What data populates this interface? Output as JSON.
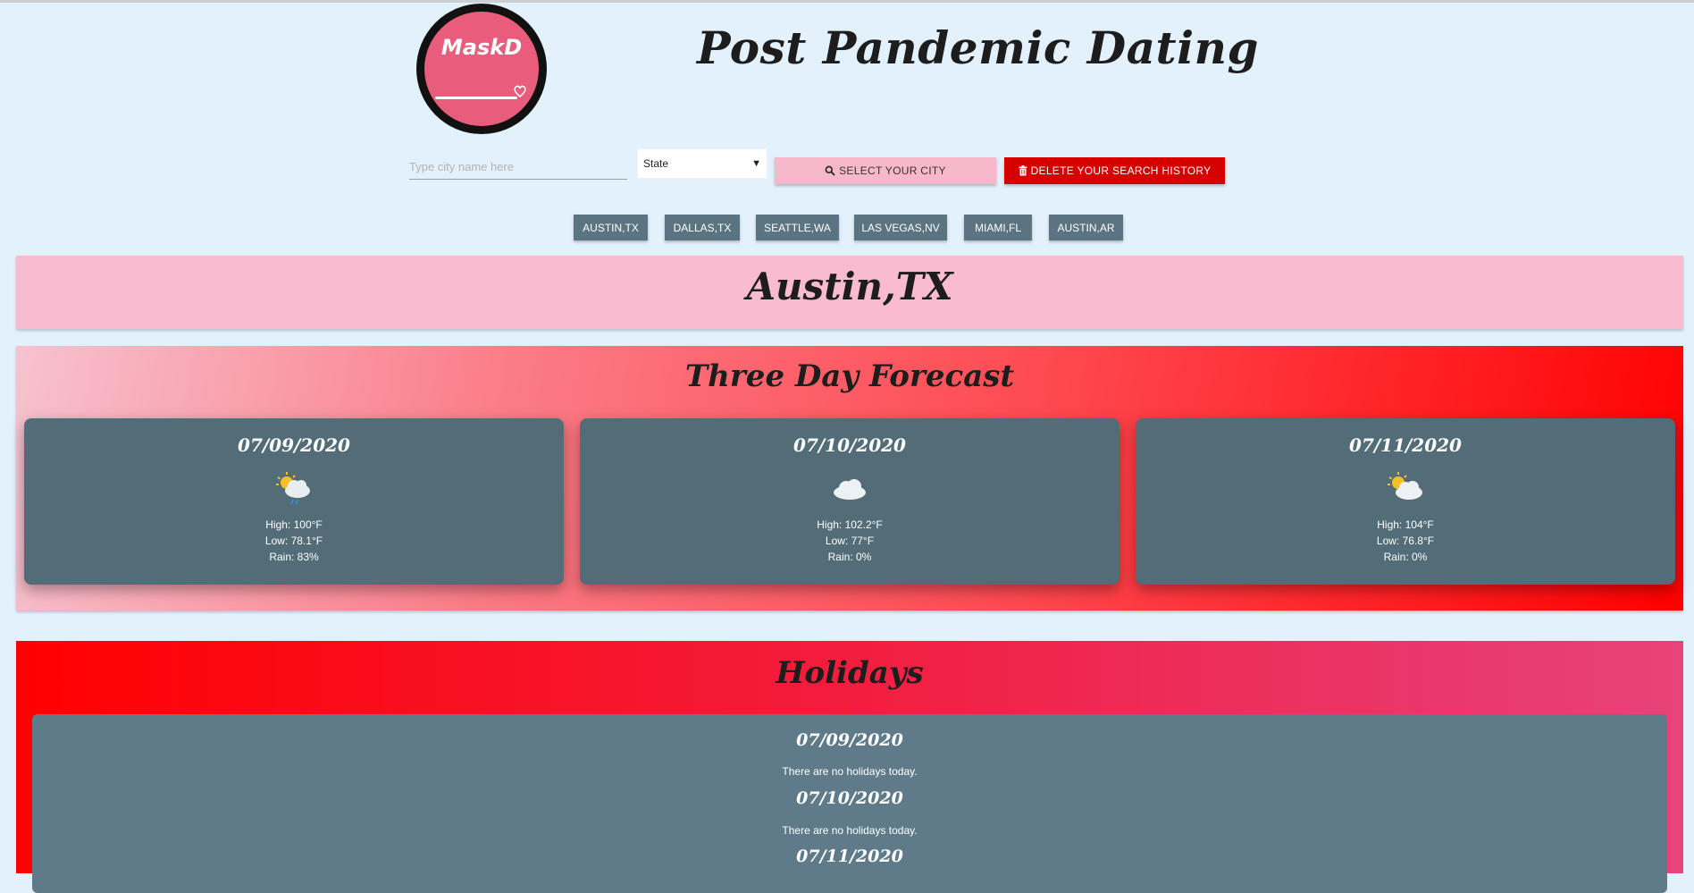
{
  "header": {
    "logo_text": "MaskD",
    "title": "Post Pandemic Dating"
  },
  "search": {
    "city_placeholder": "Type city name here",
    "city_value": "",
    "state_selected": "State",
    "select_city_label": "Select your city",
    "delete_history_label": "Delete your search history"
  },
  "history": [
    "AUSTIN,TX",
    "DALLAS,TX",
    "SEATTLE,WA",
    "LAS VEGAS,NV",
    "MIAMI,FL",
    "AUSTIN,AR"
  ],
  "current_city": "Austin,TX",
  "forecast": {
    "title": "Three Day Forecast",
    "days": [
      {
        "date": "07/09/2020",
        "icon": "partly-cloudy-rain-icon",
        "high": "High: 100°F",
        "low": "Low: 78.1°F",
        "rain": "Rain: 83%"
      },
      {
        "date": "07/10/2020",
        "icon": "cloud-icon",
        "high": "High: 102.2°F",
        "low": "Low: 77°F",
        "rain": "Rain: 0%"
      },
      {
        "date": "07/11/2020",
        "icon": "partly-cloudy-icon",
        "high": "High: 104°F",
        "low": "Low: 76.8°F",
        "rain": "Rain: 0%"
      }
    ]
  },
  "holidays": {
    "title": "Holidays",
    "items": [
      {
        "date": "07/09/2020",
        "text": "There are no holidays today."
      },
      {
        "date": "07/10/2020",
        "text": "There are no holidays today."
      },
      {
        "date": "07/11/2020",
        "text": ""
      }
    ]
  },
  "colors": {
    "background": "#e3f1fc",
    "logo_pink": "#e95c7b",
    "banner_pink": "#f9bbd0",
    "delete_red": "#d50000",
    "chip_gray": "#5b7481",
    "card_slate": "#536d78"
  }
}
